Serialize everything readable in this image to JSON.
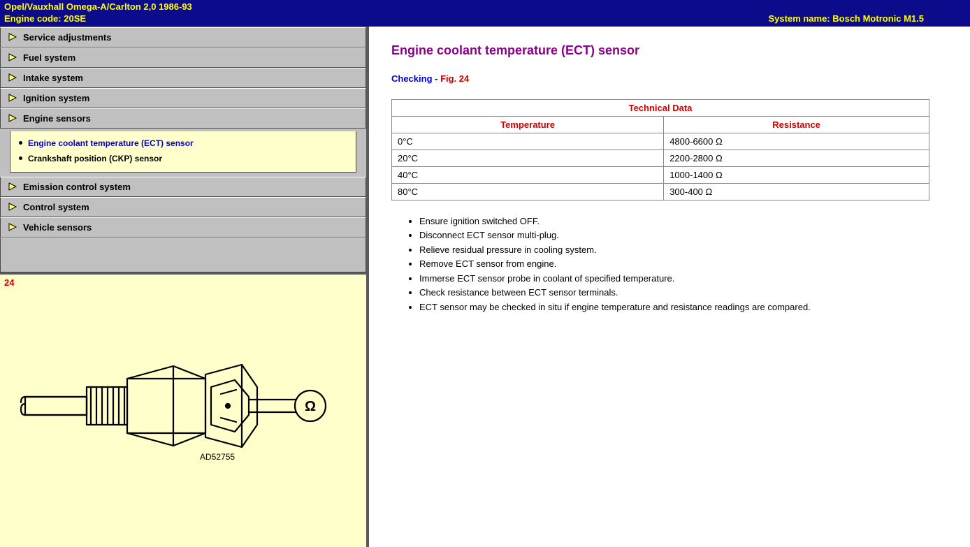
{
  "header": {
    "vehicle": "Opel/Vauxhall   Omega-A/Carlton 2,0  1986-93",
    "engine_code": "Engine code: 20SE",
    "system_name": "System name: Bosch Motronic M1.5"
  },
  "nav": {
    "items": [
      {
        "label": "Service adjustments"
      },
      {
        "label": "Fuel system"
      },
      {
        "label": "Intake system"
      },
      {
        "label": "Ignition system"
      },
      {
        "label": "Engine sensors",
        "children": [
          {
            "label": "Engine coolant temperature (ECT) sensor",
            "active": true
          },
          {
            "label": "Crankshaft position (CKP) sensor",
            "active": false
          }
        ]
      },
      {
        "label": "Emission control system"
      },
      {
        "label": "Control system"
      },
      {
        "label": "Vehicle sensors"
      }
    ]
  },
  "figure": {
    "number": "24",
    "part_code": "AD52755"
  },
  "content": {
    "title": "Engine coolant temperature (ECT) sensor",
    "checking_label": "Checking",
    "dash": " - ",
    "fig_ref": "Fig. 24",
    "table": {
      "caption": "Technical Data",
      "columns": [
        "Temperature",
        "Resistance"
      ],
      "rows": [
        [
          "0°C",
          "4800-6600 Ω"
        ],
        [
          "20°C",
          "2200-2800 Ω"
        ],
        [
          "40°C",
          "1000-1400 Ω"
        ],
        [
          "80°C",
          "300-400 Ω"
        ]
      ]
    },
    "steps": [
      "Ensure ignition switched OFF.",
      "Disconnect ECT sensor multi-plug.",
      "Relieve residual pressure in cooling system.",
      "Remove ECT sensor from engine.",
      "Immerse ECT sensor probe in coolant of specified temperature.",
      "Check resistance between ECT sensor terminals.",
      "ECT sensor may be checked in situ if engine temperature and resistance readings are compared."
    ]
  }
}
